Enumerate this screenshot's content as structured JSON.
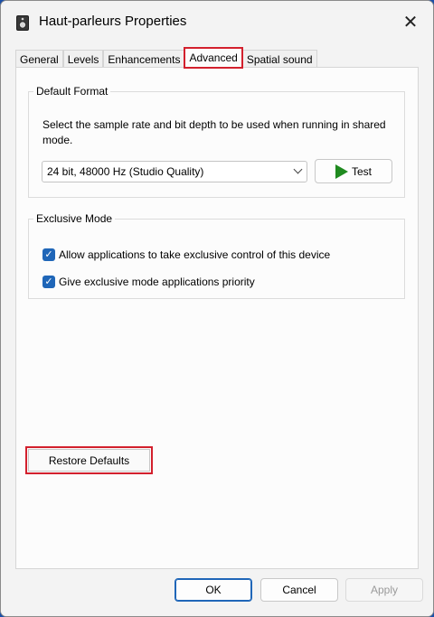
{
  "window": {
    "title": "Haut-parleurs Properties",
    "close_glyph": "✕"
  },
  "tabs": [
    {
      "label": "General",
      "active": false
    },
    {
      "label": "Levels",
      "active": false
    },
    {
      "label": "Enhancements",
      "active": false
    },
    {
      "label": "Advanced",
      "active": true
    },
    {
      "label": "Spatial sound",
      "active": false
    }
  ],
  "default_format": {
    "legend": "Default Format",
    "description": "Select the sample rate and bit depth to be used when running in shared mode.",
    "selected_format": "24 bit, 48000 Hz (Studio Quality)",
    "test_label": "Test"
  },
  "exclusive_mode": {
    "legend": "Exclusive Mode",
    "options": [
      {
        "label": "Allow applications to take exclusive control of this device",
        "checked": true
      },
      {
        "label": "Give exclusive mode applications priority",
        "checked": true
      }
    ]
  },
  "restore_label": "Restore Defaults",
  "footer": {
    "ok_label": "OK",
    "cancel_label": "Cancel",
    "apply_label": "Apply"
  },
  "colors": {
    "accent": "#1f66b8",
    "highlight": "#d3202d",
    "play": "#1f8a1f"
  }
}
